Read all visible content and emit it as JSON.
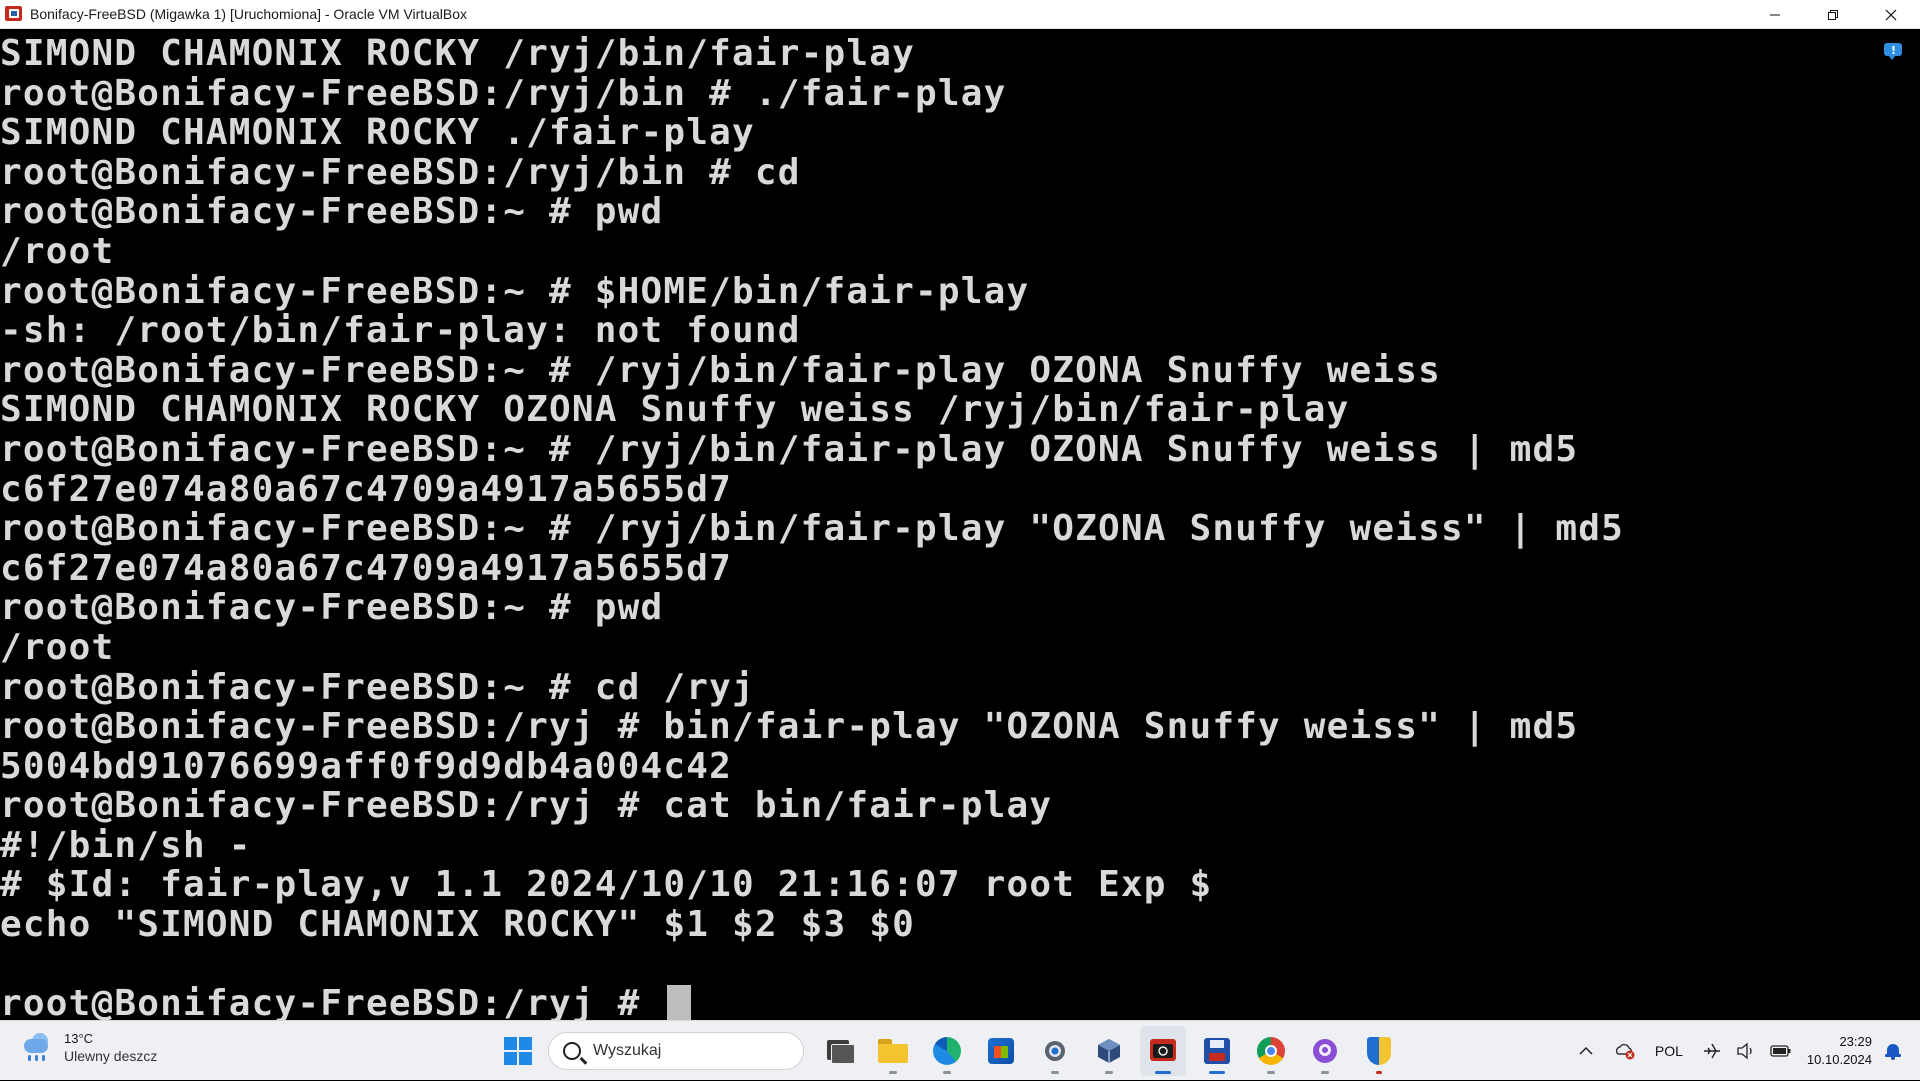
{
  "window": {
    "title": "Bonifacy-FreeBSD (Migawka 1) [Uruchomiona] - Oracle VM VirtualBox",
    "controls": {
      "minimize": "—",
      "restore": "❐",
      "close": "✕"
    }
  },
  "terminal": {
    "lines": [
      "SIMOND CHAMONIX ROCKY /ryj/bin/fair-play",
      "root@Bonifacy-FreeBSD:/ryj/bin # ./fair-play",
      "SIMOND CHAMONIX ROCKY ./fair-play",
      "root@Bonifacy-FreeBSD:/ryj/bin # cd",
      "root@Bonifacy-FreeBSD:~ # pwd",
      "/root",
      "root@Bonifacy-FreeBSD:~ # $HOME/bin/fair-play",
      "-sh: /root/bin/fair-play: not found",
      "root@Bonifacy-FreeBSD:~ # /ryj/bin/fair-play OZONA Snuffy weiss",
      "SIMOND CHAMONIX ROCKY OZONA Snuffy weiss /ryj/bin/fair-play",
      "root@Bonifacy-FreeBSD:~ # /ryj/bin/fair-play OZONA Snuffy weiss | md5",
      "c6f27e074a80a67c4709a4917a5655d7",
      "root@Bonifacy-FreeBSD:~ # /ryj/bin/fair-play \"OZONA Snuffy weiss\" | md5",
      "c6f27e074a80a67c4709a4917a5655d7",
      "root@Bonifacy-FreeBSD:~ # pwd",
      "/root",
      "root@Bonifacy-FreeBSD:~ # cd /ryj",
      "root@Bonifacy-FreeBSD:/ryj # bin/fair-play \"OZONA Snuffy weiss\" | md5",
      "5004bd91076699aff0f9d9db4a004c42",
      "root@Bonifacy-FreeBSD:/ryj # cat bin/fair-play",
      "#!/bin/sh -",
      "# $Id: fair-play,v 1.1 2024/10/10 21:16:07 root Exp $",
      "echo \"SIMOND CHAMONIX ROCKY\" $1 $2 $3 $0",
      "",
      "root@Bonifacy-FreeBSD:/ryj # "
    ],
    "colors": {
      "background": "#000000",
      "text": "#d9d9d9",
      "cursor": "#bdbdbd"
    }
  },
  "taskbar": {
    "weather": {
      "temp": "13°C",
      "desc": "Ulewny deszcz"
    },
    "search": {
      "placeholder": "Wyszukaj"
    },
    "apps": [
      "task-view-icon",
      "file-explorer-icon",
      "edge-icon",
      "store-icon",
      "settings-icon",
      "virtualbox-icon",
      "terminal-app-icon",
      "save-app-icon",
      "chrome-icon",
      "github-icon",
      "security-icon"
    ],
    "tray": {
      "chevron": "^",
      "language": "POL",
      "time": "23:29",
      "date": "10.10.2024"
    },
    "colors": {
      "accent": "#1f6fd0",
      "background": "#eef0f4"
    }
  }
}
